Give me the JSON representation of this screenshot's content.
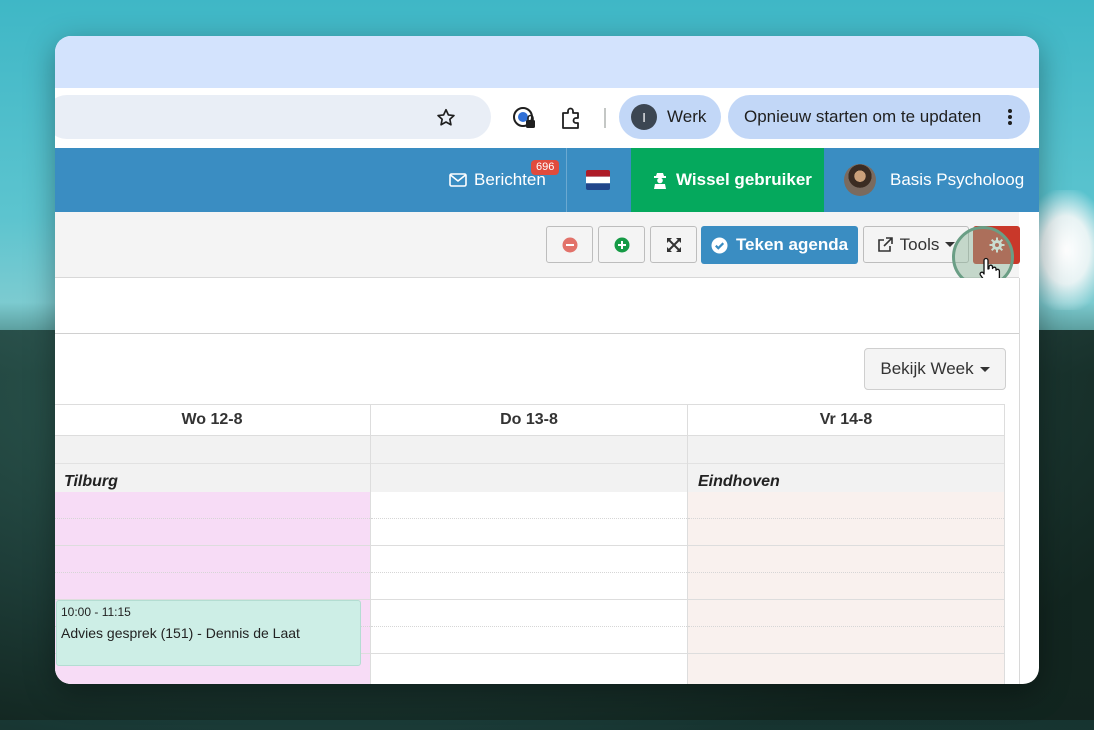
{
  "browser": {
    "profile_initial": "I",
    "profile_name": "Werk",
    "update_label": "Opnieuw starten om te updaten"
  },
  "nav": {
    "messages_label": "Berichten",
    "messages_count": "696",
    "switch_user_label": "Wissel gebruiker",
    "user_name": "Basis Psycholoog"
  },
  "actions": {
    "teken_label": "Teken agenda",
    "tools_label": "Tools"
  },
  "view": {
    "week_label": "Bekijk Week"
  },
  "calendar": {
    "days": [
      {
        "label": "Wo 12-8",
        "location": "Tilburg"
      },
      {
        "label": "Do 13-8",
        "location": ""
      },
      {
        "label": "Vr 14-8",
        "location": "Eindhoven"
      }
    ],
    "event": {
      "time": "10:00 - 11:15",
      "title": "Advies gesprek (151) - Dennis de Laat"
    }
  },
  "colors": {
    "nav_blue": "#3a8dc2",
    "switch_green": "#05a95d",
    "gear_red": "#c9382a",
    "tilburg_bg": "#f7dcf6",
    "eindhoven_bg": "#f9f1ee",
    "event_bg": "#cdeee6"
  }
}
